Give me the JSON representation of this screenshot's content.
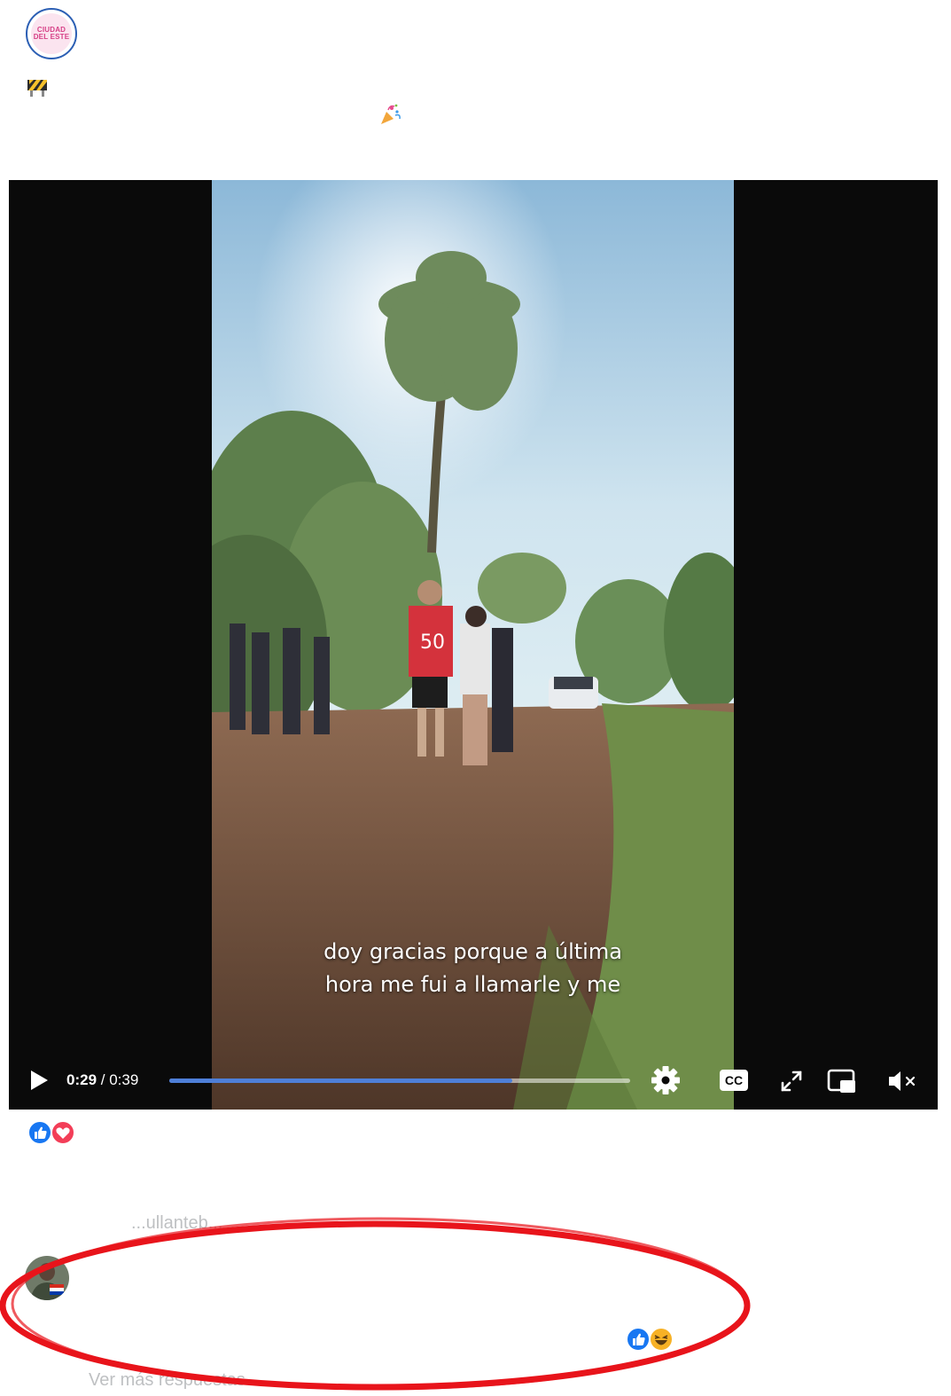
{
  "header": {
    "page_avatar_line1": "CIUDAD",
    "page_avatar_line2": "DEL ESTE",
    "emoji_construction": "construction-icon",
    "emoji_party": "party-popper-icon"
  },
  "video": {
    "subtitle_line1": "doy gracias porque a última",
    "subtitle_line2": "hora me fui a llamarle y me",
    "current_time": "0:29",
    "separator": " / ",
    "duration": "0:39",
    "progress_fraction": 0.744,
    "controls": [
      "play-icon",
      "settings-icon",
      "closed-captions-icon",
      "fullscreen-icon",
      "picture-in-picture-icon",
      "muted-volume-icon"
    ],
    "cc_label": "CC"
  },
  "reactions": [
    "like-icon",
    "love-icon"
  ],
  "comment": {
    "faded_top_text": "...ullanteb...",
    "faded_bottom_text": "Ver más respuestas",
    "reactions": [
      "like-icon",
      "haha-icon"
    ]
  },
  "colors": {
    "progress_fill": "#4e7fd8",
    "annotation_red": "#e8141b",
    "like_blue": "#1877f2",
    "love_red": "#f33e58"
  }
}
